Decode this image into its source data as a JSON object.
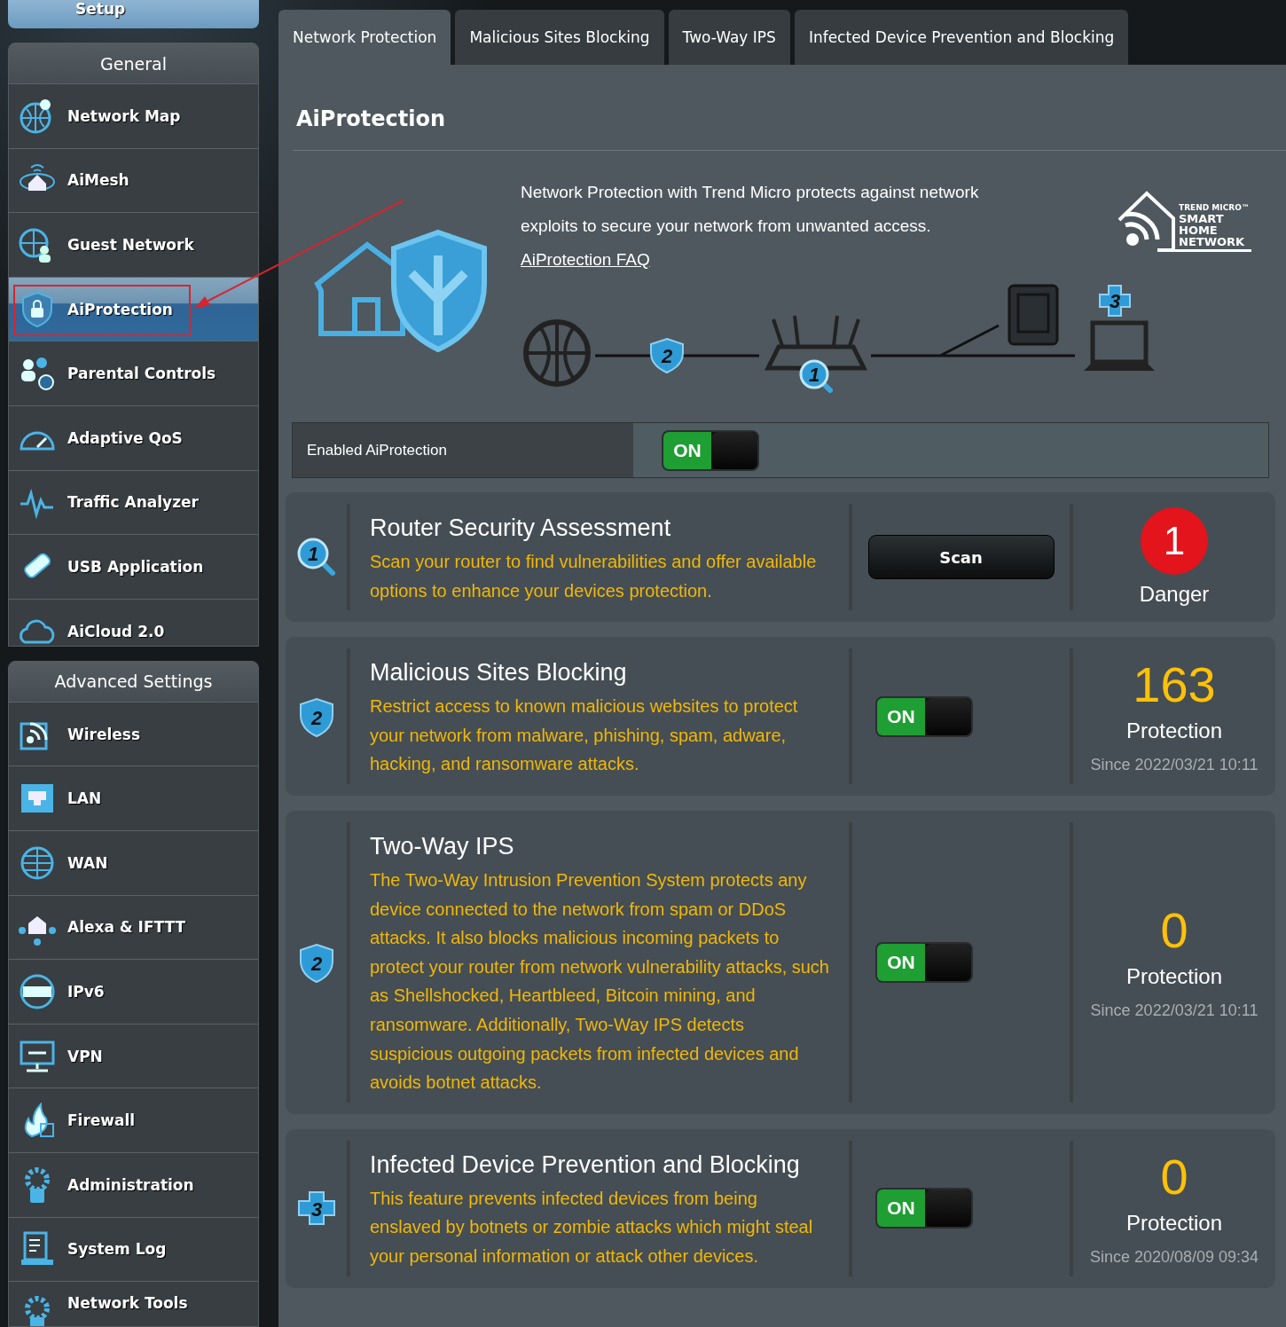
{
  "sidebar": {
    "setup_label": "Setup",
    "sections": [
      {
        "title": "General",
        "items": [
          {
            "label": "Network Map",
            "selected": false,
            "annotated": false
          },
          {
            "label": "AiMesh",
            "selected": false,
            "annotated": false
          },
          {
            "label": "Guest Network",
            "selected": false,
            "annotated": false
          },
          {
            "label": "AiProtection",
            "selected": true,
            "annotated": true
          },
          {
            "label": "Parental Controls",
            "selected": false,
            "annotated": false
          },
          {
            "label": "Adaptive QoS",
            "selected": false,
            "annotated": false
          },
          {
            "label": "Traffic Analyzer",
            "selected": false,
            "annotated": false
          },
          {
            "label": "USB Application",
            "selected": false,
            "annotated": false
          },
          {
            "label": "AiCloud 2.0",
            "selected": false,
            "annotated": false
          }
        ]
      },
      {
        "title": "Advanced Settings",
        "items": [
          {
            "label": "Wireless",
            "selected": false,
            "annotated": false
          },
          {
            "label": "LAN",
            "selected": false,
            "annotated": false
          },
          {
            "label": "WAN",
            "selected": false,
            "annotated": false
          },
          {
            "label": "Alexa & IFTTT",
            "selected": false,
            "annotated": false
          },
          {
            "label": "IPv6",
            "selected": false,
            "annotated": false
          },
          {
            "label": "VPN",
            "selected": false,
            "annotated": false
          },
          {
            "label": "Firewall",
            "selected": false,
            "annotated": false
          },
          {
            "label": "Administration",
            "selected": false,
            "annotated": false
          },
          {
            "label": "System Log",
            "selected": false,
            "annotated": false
          },
          {
            "label": "Network Tools",
            "selected": false,
            "annotated": false
          }
        ]
      }
    ]
  },
  "tabs": [
    {
      "label": "Network Protection",
      "selected": true
    },
    {
      "label": "Malicious Sites Blocking",
      "selected": false
    },
    {
      "label": "Two-Way IPS",
      "selected": false
    },
    {
      "label": "Infected Device Prevention and Blocking",
      "selected": false
    }
  ],
  "page": {
    "title": "AiProtection",
    "intro": "Network Protection with Trend Micro protects against network exploits to secure your network from unwanted access.",
    "faq_link": "AiProtection FAQ",
    "logo": {
      "brand": "TREND MICRO™",
      "lines": [
        "SMART",
        "HOME",
        "NETWORK"
      ]
    },
    "diagram_badges": [
      "2",
      "1",
      "3"
    ]
  },
  "master_switch": {
    "label": "Enabled AiProtection",
    "on": true,
    "on_text": "ON"
  },
  "features": [
    {
      "kind": "scan",
      "badge": "1",
      "title": "Router Security Assessment",
      "description": "Scan your router to find vulnerabilities and offer available options to enhance your devices protection.",
      "button": "Scan",
      "result": {
        "kind": "danger",
        "value": "1",
        "label": "Danger"
      }
    },
    {
      "kind": "toggle",
      "badge": "2",
      "title": "Malicious Sites Blocking",
      "description": "Restrict access to known malicious websites to protect your network from malware, phishing, spam, adware, hacking, and ransomware attacks.",
      "on": true,
      "on_text": "ON",
      "result": {
        "kind": "count",
        "value": "163",
        "label": "Protection",
        "since": "Since 2022/03/21 10:11"
      }
    },
    {
      "kind": "toggle",
      "badge": "2",
      "title": "Two-Way IPS",
      "description": "The Two-Way Intrusion Prevention System protects any device connected to the network from spam or DDoS attacks. It also blocks malicious incoming packets to protect your router from network vulnerability attacks, such as Shellshocked, Heartbleed, Bitcoin mining, and ransomware. Additionally, Two-Way IPS detects suspicious outgoing packets from infected devices and avoids botnet attacks.",
      "on": true,
      "on_text": "ON",
      "result": {
        "kind": "count",
        "value": "0",
        "label": "Protection",
        "since": "Since 2022/03/21 10:11"
      }
    },
    {
      "kind": "toggle",
      "badge": "3",
      "title": "Infected Device Prevention and Blocking",
      "description": "This feature prevents infected devices from being enslaved by botnets or zombie attacks which might steal your personal information or attack other devices.",
      "on": true,
      "on_text": "ON",
      "result": {
        "kind": "count",
        "value": "0",
        "label": "Protection",
        "since": "Since 2020/08/09 09:34"
      }
    }
  ]
}
